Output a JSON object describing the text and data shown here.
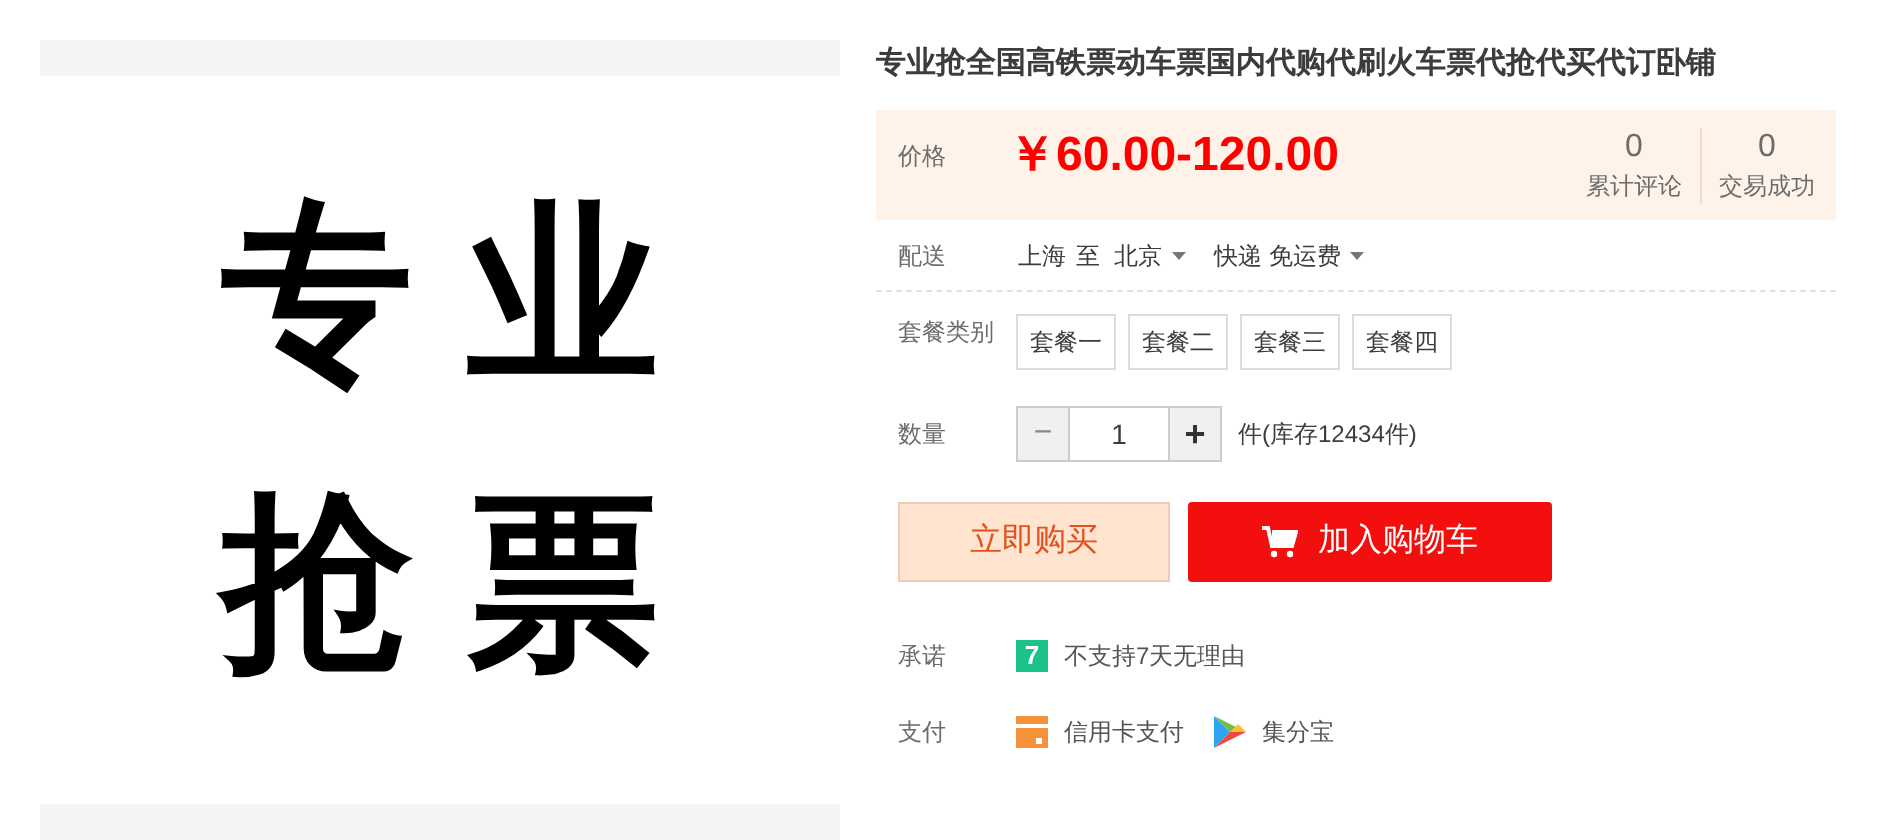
{
  "product_image": {
    "lines": [
      "专 业",
      "抢 票"
    ]
  },
  "title": "专业抢全国高铁票动车票国内代购代刷火车票代抢代买代订卧铺",
  "price": {
    "label": "价格",
    "value": "￥60.00-120.00",
    "stats": [
      {
        "count": "0",
        "label": "累计评论"
      },
      {
        "count": "0",
        "label": "交易成功"
      }
    ]
  },
  "delivery": {
    "label": "配送",
    "from": "上海",
    "to_word": "至",
    "to": "北京",
    "shipping": "快递 免运费"
  },
  "packages": {
    "label": "套餐类别",
    "options": [
      {
        "label": "套餐一",
        "selected": false
      },
      {
        "label": "套餐二",
        "selected": false
      },
      {
        "label": "套餐三",
        "selected": false
      },
      {
        "label": "套餐四",
        "selected": false
      }
    ]
  },
  "quantity": {
    "label": "数量",
    "minus": "−",
    "value": "1",
    "plus": "+",
    "minus_disabled": true,
    "stock": "件(库存12434件)"
  },
  "buttons": {
    "buy_now": "立即购买",
    "add_to_cart": "加入购物车"
  },
  "promise": {
    "label": "承诺",
    "badge": "7",
    "text": "不支持7天无理由"
  },
  "payment": {
    "label": "支付",
    "methods": [
      {
        "kind": "card",
        "text": "信用卡支付"
      },
      {
        "kind": "jifenbao",
        "text": "集分宝"
      }
    ]
  }
}
